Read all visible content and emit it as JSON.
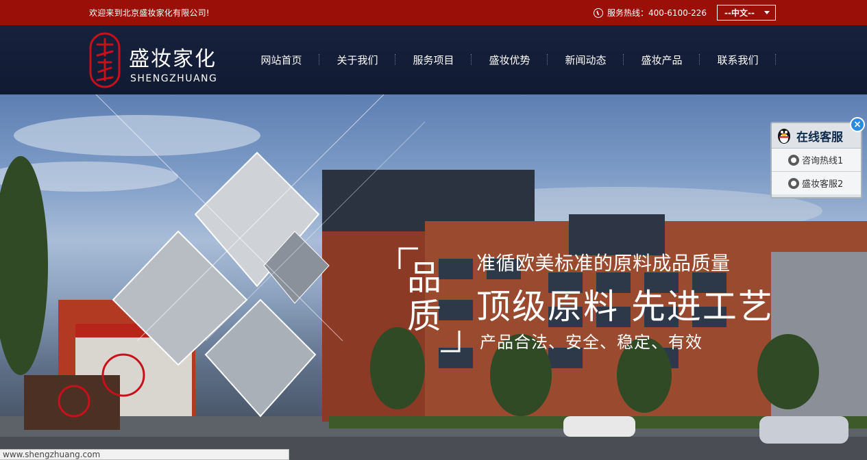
{
  "topbar": {
    "welcome": "欢迎来到北京盛妆家化有限公司!",
    "hotline": "服务热线：400-6100-226",
    "language": "--中文--"
  },
  "logo": {
    "name_cn": "盛妆家化",
    "name_en": "SHENGZHUANG"
  },
  "nav": {
    "items": [
      "网站首页",
      "关于我们",
      "服务项目",
      "盛妆优势",
      "新闻动态",
      "盛妆产品",
      "联系我们"
    ]
  },
  "banner": {
    "quality": "品质",
    "line1": "准循欧美标准的原料成品质量",
    "line2": "顶级原料  先进工艺",
    "line3": "产品合法、安全、稳定、有效"
  },
  "service": {
    "title": "在线客服",
    "items": [
      "咨询热线1",
      "盛妆客服2"
    ],
    "close": "×"
  },
  "statusbar": {
    "url": "www.shengzhuang.com"
  },
  "colors": {
    "topbar": "#9a0f07",
    "header": "#18213c",
    "accent_red": "#c8101a"
  }
}
